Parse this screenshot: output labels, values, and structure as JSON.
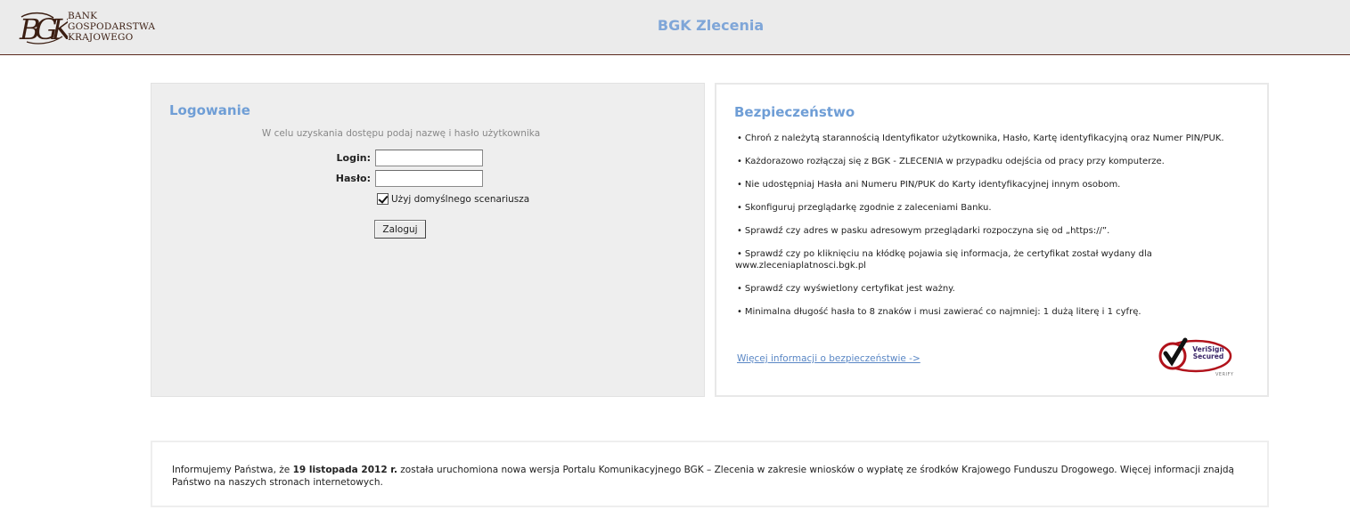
{
  "header": {
    "logo_lines": [
      "BANK",
      "GOSPODARSTWA",
      "KRAJOWEGO"
    ],
    "logo_mark": "BGK",
    "title": "BGK Zlecenia"
  },
  "login": {
    "title": "Logowanie",
    "hint": "W celu uzyskania dostępu podaj nazwę i hasło użytkownika",
    "login_label": "Login:",
    "login_value": "",
    "password_label": "Hasło:",
    "password_value": "",
    "default_scenario_label": "Użyj domyślnego scenariusza",
    "default_scenario_checked": true,
    "submit_label": "Zaloguj"
  },
  "security": {
    "title": "Bezpieczeństwo",
    "bullet": "•",
    "tips": [
      "Chroń z należytą starannością Identyfikator użytkownika, Hasło, Kartę identyfikacyjną oraz Numer PIN/PUK.",
      "Każdorazowo rozłączaj się z BGK - ZLECENIA w przypadku odejścia od pracy przy komputerze.",
      "Nie udostępniaj Hasła ani Numeru PIN/PUK do Karty identyfikacyjnej innym osobom.",
      "Skonfiguruj przeglądarkę zgodnie z zaleceniami Banku.",
      "Sprawdź czy adres w pasku adresowym przeglądarki rozpoczyna się od „https://”.",
      "Sprawdź czy po kliknięciu na kłódkę pojawia się informacja, że certyfikat został wydany dla",
      "www.zleceniaplatnosci.bgk.pl",
      "Sprawdź czy wyświetlony certyfikat jest ważny.",
      "Minimalna długość hasła to 8 znaków i musi zawierać co najmniej: 1 dużą literę i 1 cyfrę."
    ],
    "more_link": "Więcej informacji o bezpieczeństwie ->",
    "badge_line1": "VeriSign",
    "badge_line2": "Secured",
    "badge_small": "VERIFY"
  },
  "notice": {
    "text_before": "Informujemy Państwa, że ",
    "text_bold": "19 listopada 2012 r.",
    "text_after": " została uruchomiona nowa wersja Portalu Komunikacyjnego BGK – Zlecenia w zakresie wniosków o wypłatę ze środków Krajowego Funduszu Drogowego. Więcej informacji znajdą Państwo na naszych stronach internetowych."
  },
  "colors": {
    "accent_blue": "#6f9ed6",
    "brand_brown": "#3b1e12",
    "verisign_red": "#b1121b"
  }
}
